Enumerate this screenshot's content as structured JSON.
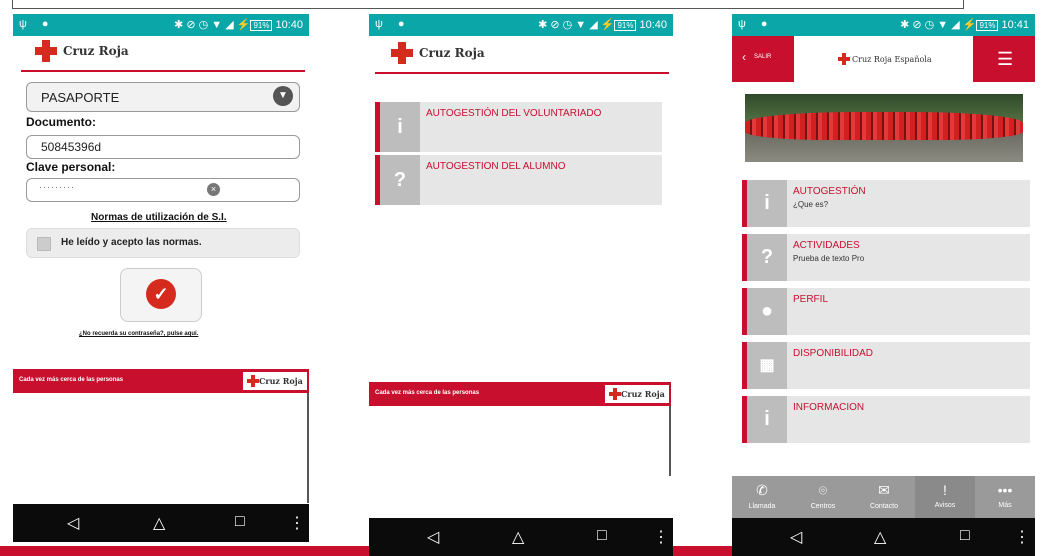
{
  "status": {
    "s1": {
      "time": "10:40",
      "battery": "91%"
    },
    "s2": {
      "time": "10:40",
      "battery": "91%"
    },
    "s3": {
      "time": "10:41",
      "battery": "91%"
    }
  },
  "icons": {
    "nav": [
      "back-icon",
      "home-icon",
      "recents-icon",
      "more-vert-icon"
    ]
  },
  "colors": {
    "brand_red": "#c8102e",
    "status_teal": "#0aa6a8",
    "nav_black": "#0b0b0b"
  },
  "login": {
    "brand": "Cruz Roja",
    "doc_type": "PASAPORTE",
    "documento_label": "Documento:",
    "documento_value": "50845396d",
    "clave_label": "Clave personal:",
    "clave_value": "·········",
    "normas_link": "Normas de utilización de S.I.",
    "accept_label": "He leído y acepto las normas.",
    "forgot_link": "¿No recuerda su contraseña?, pulse aquí.",
    "footer_text": "Cada vez más cerca de las personas",
    "footer_brand": "Cruz Roja"
  },
  "menu": {
    "brand": "Cruz Roja",
    "items": [
      {
        "title": "AUTOGESTIÓN DEL VOLUNTARIADO",
        "icon": "i"
      },
      {
        "title": "AUTOGESTION DEL ALUMNO",
        "icon": "?"
      }
    ],
    "footer_text": "Cada vez más cerca de las personas",
    "footer_brand": "Cruz Roja"
  },
  "main": {
    "back_label": "SALIR",
    "brand": "Cruz Roja Española",
    "items": [
      {
        "title": "AUTOGESTIÓN",
        "subtitle": "¿Que es?",
        "icon": "i"
      },
      {
        "title": "ACTIVIDADES",
        "subtitle": "Prueba de texto Pro",
        "icon": "?"
      },
      {
        "title": "PERFIL",
        "subtitle": "",
        "icon": "person"
      },
      {
        "title": "DISPONIBILIDAD",
        "subtitle": "",
        "icon": "calendar"
      },
      {
        "title": "INFORMACION",
        "subtitle": "",
        "icon": "i"
      }
    ],
    "tabs": [
      {
        "label": "Llamada",
        "icon": "phone-icon"
      },
      {
        "label": "Centros",
        "icon": "pin-icon"
      },
      {
        "label": "Contacto",
        "icon": "mail-icon"
      },
      {
        "label": "Avisos",
        "icon": "alert-icon"
      },
      {
        "label": "Más",
        "icon": "dots-icon"
      }
    ]
  }
}
